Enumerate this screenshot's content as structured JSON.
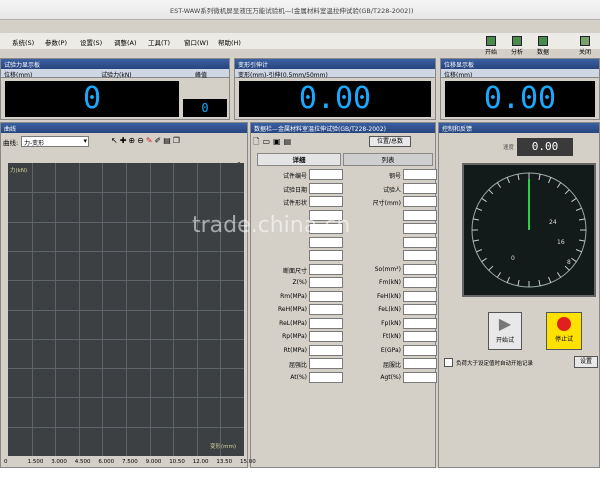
{
  "app": {
    "title": "EST-WAW系列微机屏显液压万能试验机—(金属材料室温拉伸试验(GB/T228-2002))"
  },
  "menu": {
    "items": [
      "系统(S)",
      "参数(P)",
      "设置(S)",
      "调整(A)",
      "工具(T)",
      "窗口(W)",
      "帮助(H)"
    ]
  },
  "toolbar": {
    "buttons": [
      "开始",
      "分析",
      "数据",
      "关闭"
    ]
  },
  "displays": {
    "force": {
      "header": "试验力显示板",
      "sub_left": "位移(mm)",
      "sub_mid": "试验力(kN)",
      "sub_right": "峰值",
      "value": "0",
      "peak": "0"
    },
    "stress": {
      "header": "变形引伸计",
      "sub": "变形(mm)-引伸(0.5mm/50mm)",
      "value": "0.00"
    },
    "disp": {
      "header": "位移显示板",
      "sub": "位移(mm)",
      "value": "0.00"
    }
  },
  "chart_pane": {
    "header": "曲线",
    "select_label": "曲线:",
    "select_value": "力-变形",
    "ylabel": "力(kN)",
    "xlabel": "变形(mm)"
  },
  "chart_data": {
    "type": "line",
    "title": "",
    "xlabel": "变形(mm)",
    "ylabel": "力(kN)",
    "xlim": [
      0,
      15
    ],
    "x_ticks": [
      "0",
      "1.500",
      "3.000",
      "4.500",
      "6.000",
      "7.500",
      "9.000",
      "10.50",
      "12.00",
      "13.50",
      "15.00"
    ],
    "series": []
  },
  "data_pane": {
    "header": "数据栏—金属材料室温拉伸试验(GB/T228-2002)",
    "btn_position": "位置/总数",
    "tabs": [
      "详细",
      "列表"
    ],
    "left_fields": [
      "试件编号",
      "试验日期",
      "试件形状",
      "",
      "",
      "",
      "",
      "断面尺寸",
      "Z(%)",
      "Rm(MPa)",
      "ReH(MPa)",
      "ReL(MPa)",
      "Rp(MPa)",
      "Rt(MPa)",
      "屈强比",
      "At(%)"
    ],
    "right_fields": [
      "钢号",
      "试验人",
      "尺寸(mm)",
      "",
      "",
      "",
      "",
      "So(mm²)",
      "Fm(kN)",
      "FeH(kN)",
      "FeL(kN)",
      "Fp(kN)",
      "Ft(kN)",
      "E(GPa)",
      "屈服比",
      "Agt(%)"
    ]
  },
  "control_pane": {
    "header": "控制和反馈",
    "setpoint_label": "速度",
    "setpoint_value": "0.00",
    "gauge_labels": [
      "0",
      "8",
      "16",
      "24"
    ],
    "btn_start": "开始试",
    "btn_stop": "停止试",
    "checkbox_label": "负荷大于设定值时自动开始记录",
    "settings_btn": "设置"
  },
  "watermark": "trade.china.cn"
}
